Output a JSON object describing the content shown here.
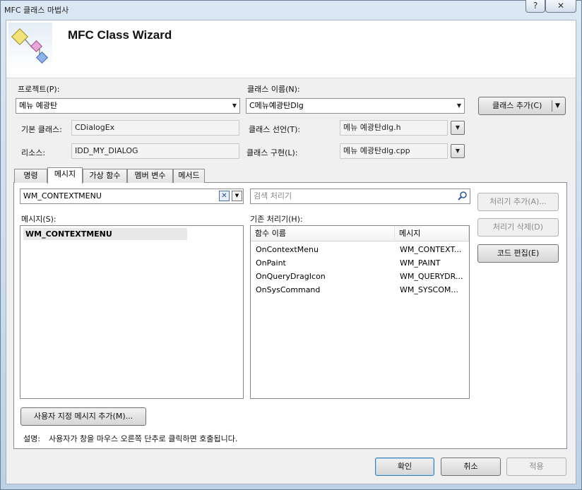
{
  "window": {
    "title": "MFC 클래스 마법사",
    "help_glyph": "?",
    "close_glyph": "✕"
  },
  "banner": {
    "title": "MFC Class Wizard"
  },
  "project": {
    "label": "프로젝트(P):",
    "value": "메뉴 예광탄"
  },
  "class_name": {
    "label": "클래스 이름(N):",
    "value": "C메뉴예광탄Dlg"
  },
  "add_class_button": "클래스 추가(C)",
  "base_class": {
    "label": "기본 클래스:",
    "value": "CDialogEx"
  },
  "resource": {
    "label": "리소스:",
    "value": "IDD_MY_DIALOG"
  },
  "class_declaration": {
    "label": "클래스 선언(T):",
    "value": "메뉴 예광탄dlg.h"
  },
  "class_implementation": {
    "label": "클래스 구현(L):",
    "value": "메뉴 예광탄dlg.cpp"
  },
  "tabs": [
    "명령",
    "메시지",
    "가상 함수",
    "멤버 변수",
    "메서드"
  ],
  "message_filter": {
    "value": "WM_CONTEXTMENU"
  },
  "handler_search": {
    "placeholder": "검색 처리기"
  },
  "messages": {
    "label": "메시지(S):",
    "items": [
      "WM_CONTEXTMENU"
    ]
  },
  "existing_handlers": {
    "label": "기존 처리기(H):",
    "columns": [
      "함수 이름",
      "메시지"
    ],
    "rows": [
      {
        "function": "OnContextMenu",
        "message": "WM_CONTEXT..."
      },
      {
        "function": "OnPaint",
        "message": "WM_PAINT"
      },
      {
        "function": "OnQueryDragIcon",
        "message": "WM_QUERYDR..."
      },
      {
        "function": "OnSysCommand",
        "message": "WM_SYSCOM..."
      }
    ]
  },
  "side_buttons": {
    "add_handler": "처리기 추가(A)...",
    "delete_handler": "처리기 삭제(D)",
    "edit_code": "코드 편집(E)"
  },
  "custom_message_button": "사용자 지정 메시지 추가(M)...",
  "description": {
    "label": "설명:",
    "text": "사용자가 창을 마우스 오른쪽 단추로 클릭하면 호출됩니다."
  },
  "footer": {
    "ok": "확인",
    "cancel": "취소",
    "apply": "적용"
  },
  "icons": {
    "dropdown": "▼",
    "clear": "✕",
    "search": "search-icon"
  }
}
